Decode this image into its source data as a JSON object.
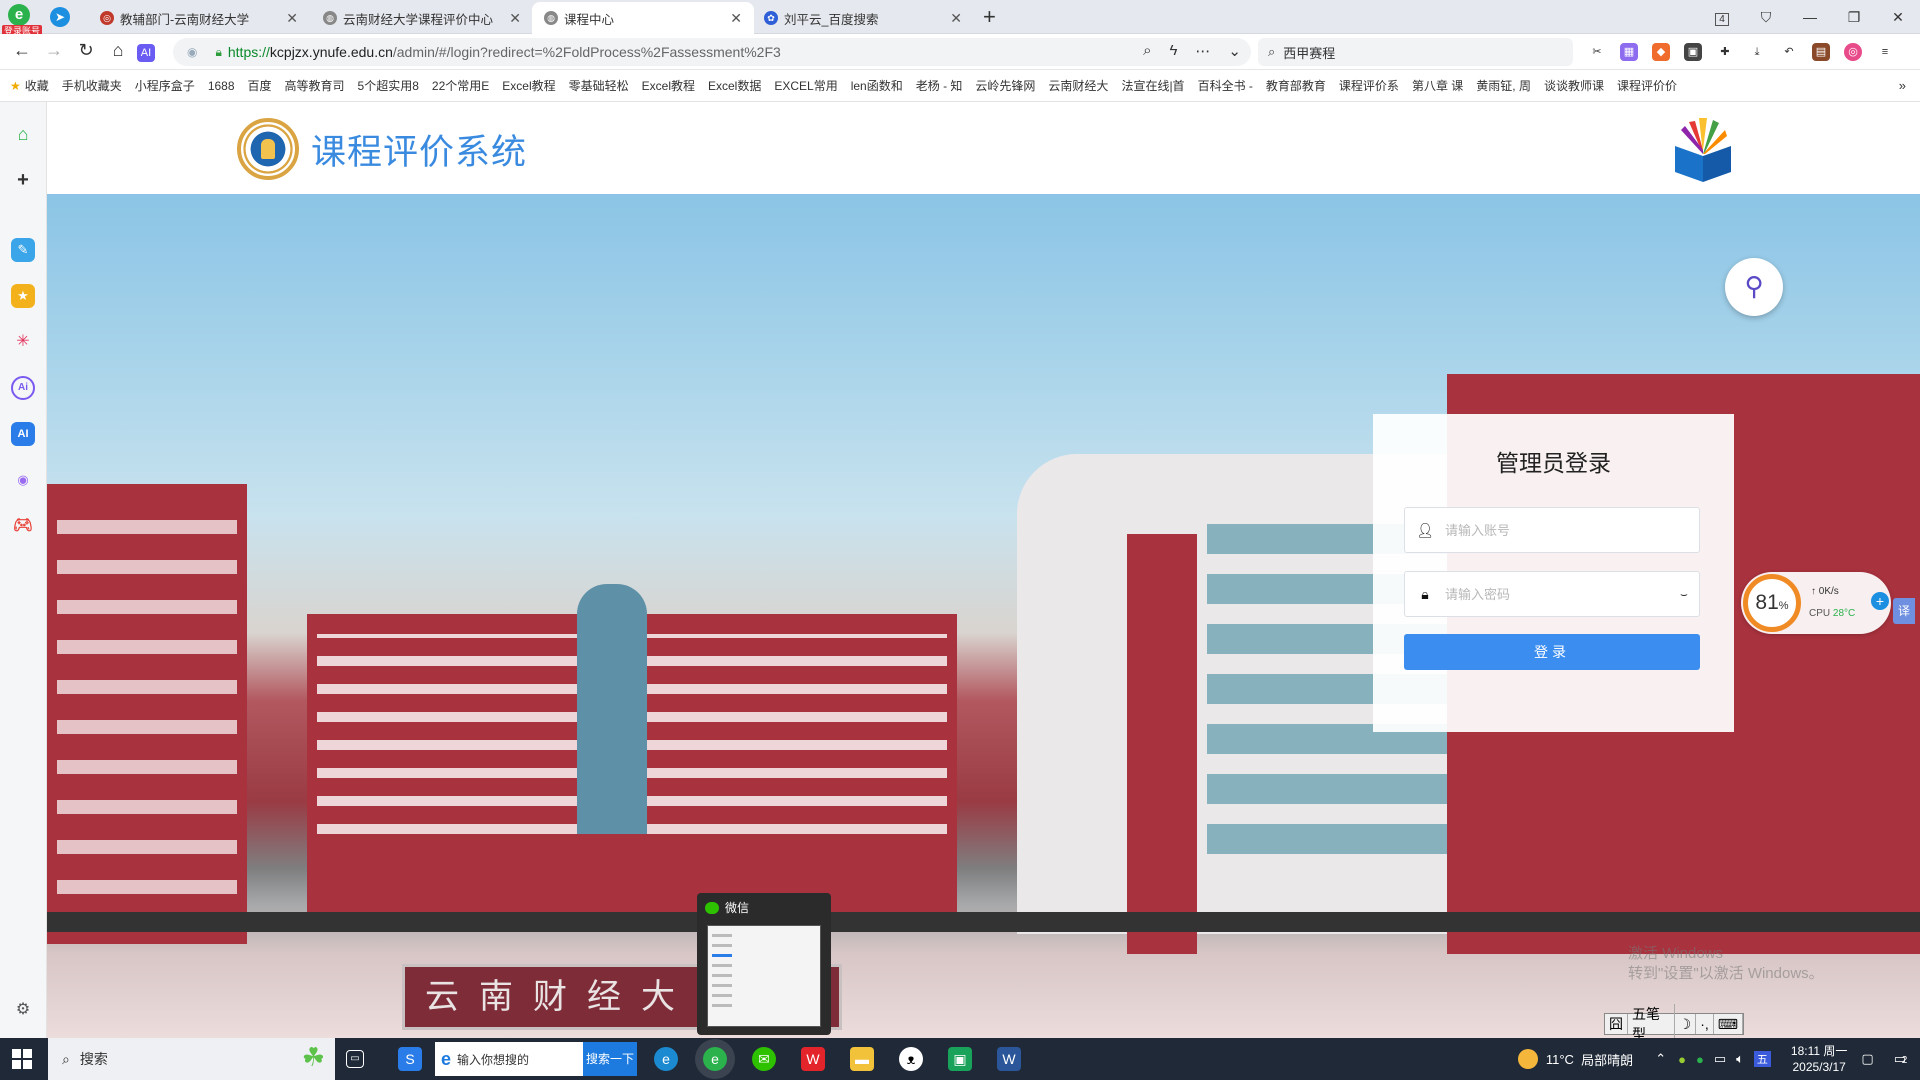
{
  "browser": {
    "account_badge": "登录账号",
    "tabs": [
      {
        "title": "教辅部门-云南财经大学",
        "active": false,
        "favicon": "university-icon"
      },
      {
        "title": "云南财经大学课程评价中心",
        "active": false,
        "favicon": "globe-icon"
      },
      {
        "title": "课程中心",
        "active": true,
        "favicon": "globe-icon"
      },
      {
        "title": "刘平云_百度搜索",
        "active": false,
        "favicon": "baidu-paw-icon"
      }
    ],
    "tab_counter": "4",
    "address": {
      "scheme": "https://",
      "host": "kcpjzx.ynufe.edu.cn",
      "path": "/admin/#/login?redirect=%2FoldProcess%2Fassessment%2F3"
    },
    "search_value": "西甲赛程"
  },
  "bookmarks": [
    "收藏",
    "手机收藏夹",
    "小程序盒子",
    "1688",
    "百度",
    "高等教育司",
    "5个超实用8",
    "22个常用E",
    "Excel教程",
    "零基础轻松",
    "Excel教程",
    "Excel数据",
    "EXCEL常用",
    "len函数和",
    "老杨 - 知",
    "云岭先锋网",
    "云南财经大",
    "法宣在线|首",
    "百科全书 - ",
    "教育部教育",
    "课程评价系",
    "第八章 课",
    "黄雨钲, 周",
    "谈谈教师课",
    "课程评价价"
  ],
  "site": {
    "title": "课程评价系统",
    "sign_text": "云南财经大学"
  },
  "login": {
    "heading": "管理员登录",
    "account_placeholder": "请输入账号",
    "password_placeholder": "请输入密码",
    "submit_label": "登录"
  },
  "monitor": {
    "cpu_percent": "81",
    "percent_sign": "%",
    "net_speed": "0K/s",
    "cpu_label": "CPU",
    "cpu_temp": "28°C",
    "translate_label": "译"
  },
  "wechat_popup": {
    "title": "微信"
  },
  "watermark": {
    "line1": "激活 Windows",
    "line2": "转到\"设置\"以激活 Windows。"
  },
  "ime": {
    "mode": "五笔型"
  },
  "taskbar": {
    "search_label": "搜索",
    "ie_placeholder": "输入你想搜的",
    "ie_button": "搜索一下",
    "weather_temp": "11°C",
    "weather_desc": "局部晴朗",
    "time": "18:11 周一",
    "date": "2025/3/17",
    "notif_count": "2"
  },
  "colors": {
    "accent": "#3b8ef0",
    "site_title": "#3a8be0",
    "taskbar": "#1f2937"
  }
}
